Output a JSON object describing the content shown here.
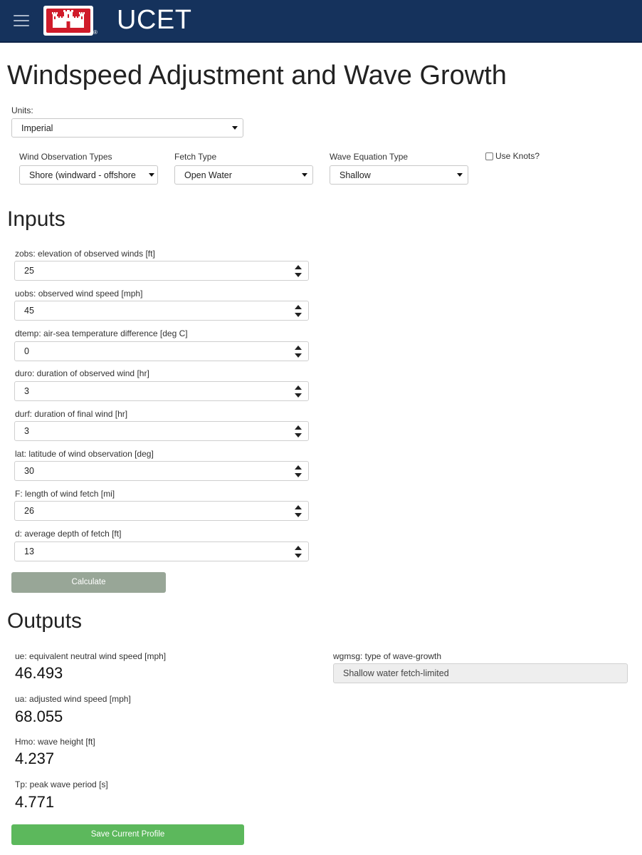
{
  "header": {
    "app_name": "UCET",
    "logo_registered_mark": "®",
    "brand_color": "#15325c",
    "logo_color": "#d01b2a",
    "menu_icon": "hamburger-menu-icon"
  },
  "page": {
    "title": "Windspeed Adjustment and Wave Growth"
  },
  "units": {
    "label": "Units:",
    "selected": "Imperial"
  },
  "wind_observation": {
    "label": "Wind Observation Types",
    "selected": "Shore (windward - offshore"
  },
  "fetch_type": {
    "label": "Fetch Type",
    "selected": "Open Water"
  },
  "wave_equation": {
    "label": "Wave Equation Type",
    "selected": "Shallow"
  },
  "use_knots": {
    "label": "Use Knots?",
    "checked": false
  },
  "inputs": {
    "heading": "Inputs",
    "fields": [
      {
        "label": "zobs: elevation of observed winds [ft]",
        "value": "25"
      },
      {
        "label": "uobs: observed wind speed [mph]",
        "value": "45"
      },
      {
        "label": "dtemp: air-sea temperature difference [deg C]",
        "value": "0"
      },
      {
        "label": "duro: duration of observed wind [hr]",
        "value": "3"
      },
      {
        "label": "durf: duration of final wind [hr]",
        "value": "3"
      },
      {
        "label": "lat: latitude of wind observation [deg]",
        "value": "30"
      },
      {
        "label": "F: length of wind fetch [mi]",
        "value": "26"
      },
      {
        "label": "d: average depth of fetch [ft]",
        "value": "13"
      }
    ],
    "calculate_label": "Calculate"
  },
  "outputs": {
    "heading": "Outputs",
    "values": [
      {
        "label": "ue: equivalent neutral wind speed [mph]",
        "value": "46.493"
      },
      {
        "label": "ua: adjusted wind speed [mph]",
        "value": "68.055"
      },
      {
        "label": "Hmo: wave height [ft]",
        "value": "4.237"
      },
      {
        "label": "Tp: peak wave period [s]",
        "value": "4.771"
      }
    ],
    "wgmsg": {
      "label": "wgmsg: type of wave-growth",
      "value": "Shallow water fetch-limited"
    },
    "save_label": "Save Current Profile"
  }
}
